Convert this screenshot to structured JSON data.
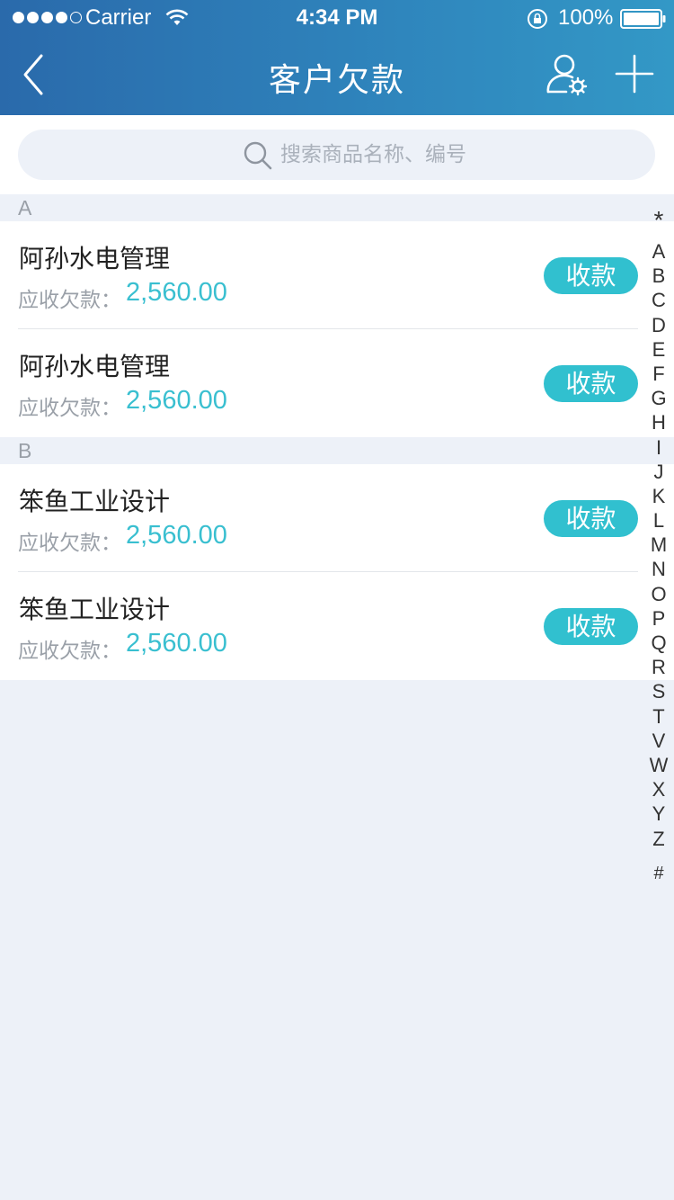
{
  "status_bar": {
    "carrier": "Carrier",
    "time": "4:34 PM",
    "battery": "100%"
  },
  "nav": {
    "title": "客户欠款",
    "icons": [
      "back-chevron-icon",
      "user-settings-icon",
      "plus-icon"
    ]
  },
  "search": {
    "placeholder": "搜索商品名称、编号"
  },
  "sections": [
    {
      "letter": "A",
      "items": [
        {
          "name": "阿孙水电管理",
          "debt_label": "应收欠款：",
          "debt_value": "2,560.00",
          "action": "收款"
        },
        {
          "name": "阿孙水电管理",
          "debt_label": "应收欠款：",
          "debt_value": "2,560.00",
          "action": "收款"
        }
      ]
    },
    {
      "letter": "B",
      "items": [
        {
          "name": "笨鱼工业设计",
          "debt_label": "应收欠款：",
          "debt_value": "2,560.00",
          "action": "收款"
        },
        {
          "name": "笨鱼工业设计",
          "debt_label": "应收欠款：",
          "debt_value": "2,560.00",
          "action": "收款"
        }
      ]
    }
  ],
  "index": [
    "*",
    "A",
    "B",
    "C",
    "D",
    "E",
    "F",
    "G",
    "H",
    "I",
    "J",
    "K",
    "L",
    "M",
    "N",
    "O",
    "P",
    "Q",
    "R",
    "S",
    "T",
    "V",
    "W",
    "X",
    "Y",
    "Z",
    "#"
  ],
  "colors": {
    "header_start": "#2a6aab",
    "header_end": "#3398c6",
    "accent": "#31c0cf",
    "amount": "#39bfd0",
    "background": "#edf1f8"
  }
}
